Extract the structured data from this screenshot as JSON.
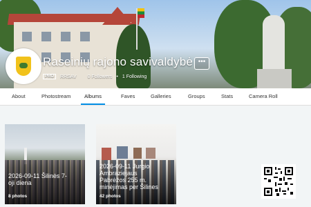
{
  "profile": {
    "name": "Raseinių rajono savivaldybė",
    "badge": "PRO",
    "username": "RRSAV",
    "followers": "0 Followers",
    "separator": "•",
    "following": "1 Following",
    "more_label": "•••"
  },
  "tabs": [
    "About",
    "Photostream",
    "Albums",
    "Faves",
    "Galleries",
    "Groups",
    "Stats",
    "Camera Roll"
  ],
  "active_tab": "Albums",
  "albums": [
    {
      "title_line1": "2026-09-11 Šilinės 7-",
      "title_line2": "oji diena",
      "count": "8 photos"
    },
    {
      "title_line1": "2026-09-11 Jurgio",
      "title_line2": "Ambraziejaus",
      "title_line3": "Pabrėžos 255 m.",
      "title_line4": "minėjimas per Šilines",
      "count": "42 photos"
    }
  ],
  "colors": {
    "active_tab_underline": "#008ee6",
    "background": "#f2f5f6"
  }
}
